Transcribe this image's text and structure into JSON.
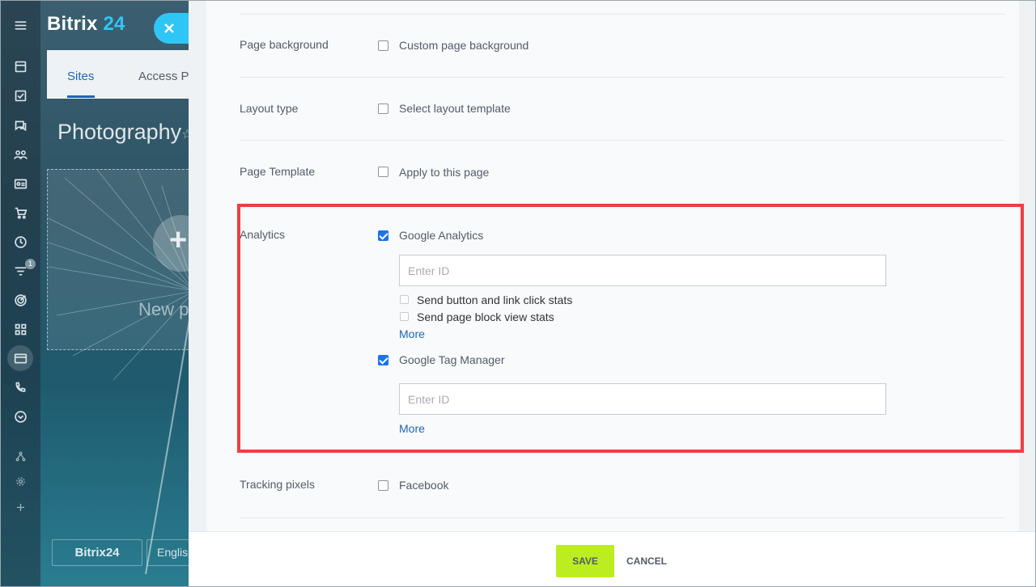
{
  "app": {
    "logo_text": "Bitrix",
    "logo_number": "24",
    "tabs": [
      {
        "label": "Sites",
        "active": true
      },
      {
        "label": "Access P",
        "active": false
      }
    ],
    "site_title": "Photography",
    "new_page_label": "New p",
    "footer_brand": "Bitrix24",
    "footer_lang": "Englis",
    "sidebar_icons": [
      "menu-icon",
      "feed-icon",
      "tasks-icon",
      "chat-icon",
      "group-icon",
      "contacts-icon",
      "shop-icon",
      "clock-icon",
      "filter-icon",
      "target-icon",
      "apps-icon",
      "sites-icon",
      "phone-icon",
      "more-icon",
      "structure-icon",
      "settings-icon",
      "plus-icon"
    ],
    "sidebar_badge": "1"
  },
  "form": {
    "rows": [
      {
        "label": "Page background",
        "checkbox_label": "Custom page background",
        "checked": false
      },
      {
        "label": "Layout type",
        "checkbox_label": "Select layout template",
        "checked": false
      },
      {
        "label": "Page Template",
        "checkbox_label": "Apply to this page",
        "checked": false
      }
    ],
    "analytics": {
      "label": "Analytics",
      "google_analytics": {
        "label": "Google Analytics",
        "checked": true,
        "input_placeholder": "Enter ID",
        "input_value": "",
        "options": [
          {
            "label": "Send button and link click stats",
            "checked": false
          },
          {
            "label": "Send page block view stats",
            "checked": false
          }
        ],
        "more_label": "More"
      },
      "google_tag_manager": {
        "label": "Google Tag Manager",
        "checked": true,
        "input_placeholder": "Enter ID",
        "input_value": "",
        "more_label": "More"
      }
    },
    "tracking": {
      "label": "Tracking pixels",
      "checkbox_label": "Facebook",
      "checked": false
    }
  },
  "actions": {
    "save_label": "SAVE",
    "cancel_label": "CANCEL"
  },
  "colors": {
    "accent_blue": "#2fc6f6",
    "save_green": "#bbed21",
    "highlight_red": "#ee3e45",
    "link_blue": "#2067b0"
  }
}
